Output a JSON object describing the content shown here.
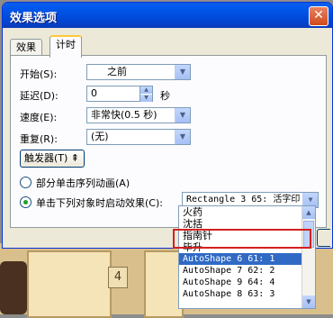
{
  "dialog": {
    "title": "效果选项",
    "close_glyph": "✕"
  },
  "tabs": [
    {
      "label": "效果"
    },
    {
      "label": "计时"
    }
  ],
  "timing": {
    "start_label": "开始(S):",
    "start_value": "之前",
    "delay_label": "延迟(D):",
    "delay_value": "0",
    "delay_unit": "秒",
    "speed_label": "速度(E):",
    "speed_value": "非常快(0.5 秒)",
    "repeat_label": "重复(R):",
    "repeat_value": "(无)",
    "trigger_button_label": "触发器(T) ⇞"
  },
  "trigger_options": {
    "option1_label": "部分单击序列动画(A)",
    "option2_label": "单击下列对象时启动效果(C):",
    "object_value": "Rectangle 3 65: 活字印"
  },
  "dropdown_list": {
    "items": [
      "火药",
      "沈括",
      "指南针",
      "毕升",
      "AutoShape 6 61: 1",
      "AutoShape 7 62: 2",
      "AutoShape 9 64: 4",
      "AutoShape 8 63: 3"
    ],
    "selected_index": 4
  },
  "background": {
    "slide_number": "4"
  },
  "colors": {
    "title_bar": "#0054e3",
    "selection": "#316ac5",
    "highlight_box": "#d42020"
  }
}
